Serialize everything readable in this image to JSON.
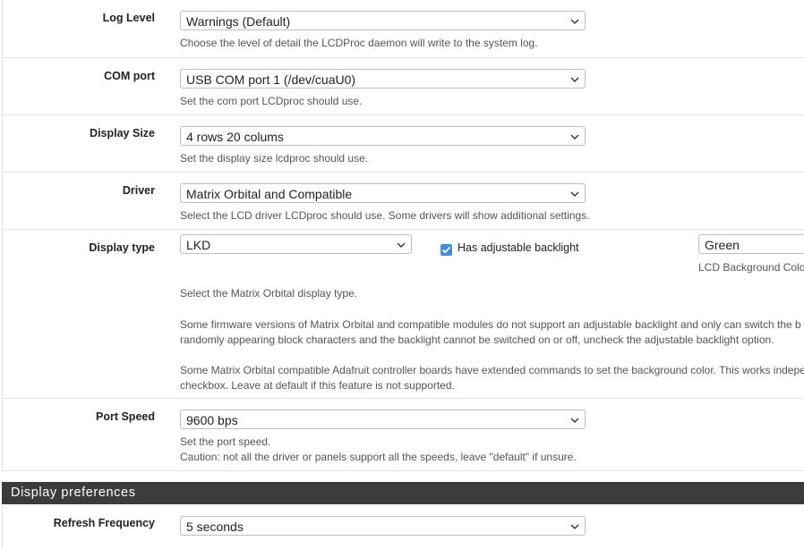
{
  "log_level": {
    "label": "Log Level",
    "value": "Warnings (Default)",
    "help": "Choose the level of detail the LCDProc daemon will write to the system log."
  },
  "com_port": {
    "label": "COM port",
    "value": "USB COM port 1 (/dev/cuaU0)",
    "help": "Set the com port LCDproc should use."
  },
  "display_size": {
    "label": "Display Size",
    "value": "4 rows 20 colums",
    "help": "Set the display size lcdproc should use."
  },
  "driver": {
    "label": "Driver",
    "value": "Matrix Orbital and Compatible",
    "help": "Select the LCD driver LCDproc should use. Some drivers will show additional settings."
  },
  "display_type": {
    "label": "Display type",
    "value": "LKD",
    "backlight_label": "Has adjustable backlight",
    "backlight_checked": true,
    "color_value": "Green",
    "color_help": "LCD Background Color",
    "help1": "Select the Matrix Orbital display type.",
    "help2a": "Some firmware versions of Matrix Orbital and compatible modules do not support an adjustable backlight and only can switch the b",
    "help2b": "randomly appearing block characters and the backlight cannot be switched on or off, uncheck the adjustable backlight option.",
    "help3a": "Some Matrix Orbital compatible Adafruit controller boards have extended commands to set the background color. This works indepe",
    "help3b": "checkbox. Leave at default if this feature is not supported."
  },
  "port_speed": {
    "label": "Port Speed",
    "value": "9600 bps",
    "help1": "Set the port speed.",
    "help2": "Caution: not all the driver or panels support all the speeds, leave \"default\" if unsure."
  },
  "section": {
    "title": "Display preferences"
  },
  "refresh": {
    "label": "Refresh Frequency",
    "value": "5 seconds"
  },
  "colors": {
    "checkbox": "#3e8fd9",
    "header_bg": "#3c3c3c"
  }
}
